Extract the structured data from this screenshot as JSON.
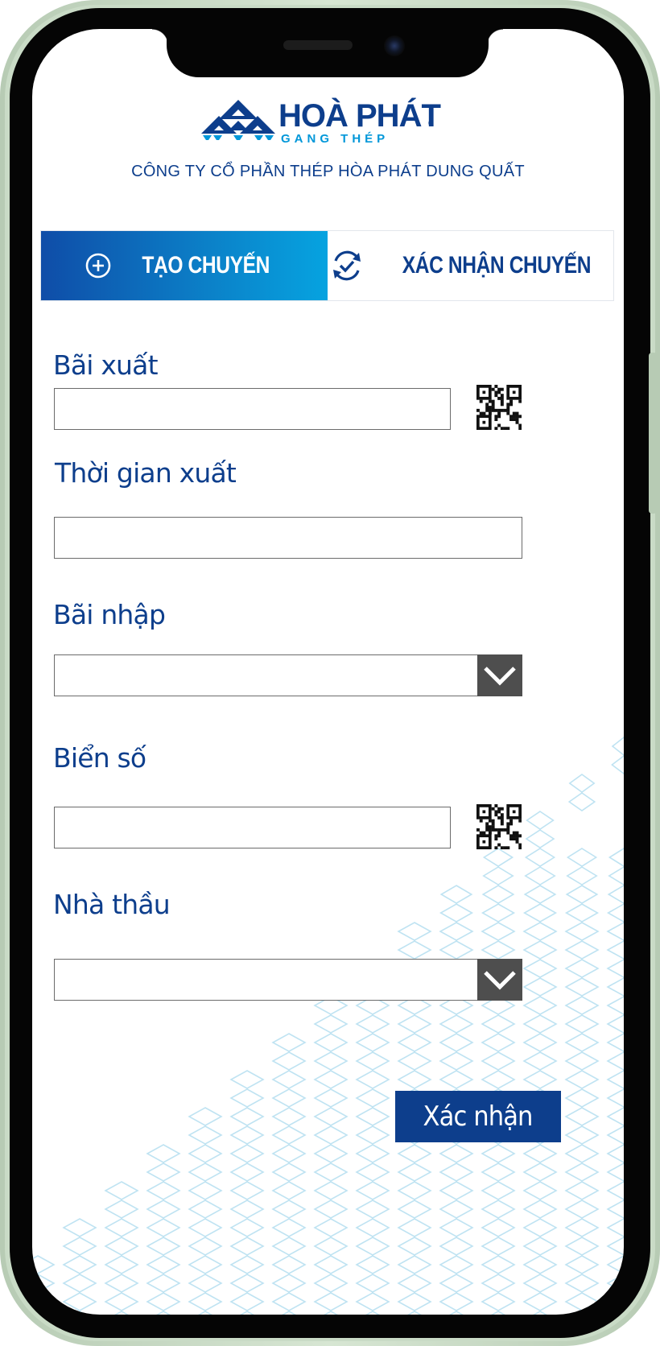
{
  "brand": {
    "name": "HOA PHAT",
    "name_display": "HOÀ PHÁT",
    "registered_mark": "®",
    "subtitle": "GANG THÉP",
    "company": "CÔNG TY CỔ PHẦN THÉP HÒA PHÁT DUNG QUẤT"
  },
  "tabs": [
    {
      "label": "TẠO CHUYẾN",
      "icon": "plus-circle-icon",
      "active": true
    },
    {
      "label": "XÁC NHẬN CHUYẾN",
      "icon": "refresh-check-icon",
      "active": false
    }
  ],
  "form": {
    "bai_xuat": {
      "label": "Bãi xuất",
      "value": "",
      "icon": "qr-code-icon"
    },
    "thoi_gian_xuat": {
      "label": "Thời gian xuất",
      "value": ""
    },
    "bai_nhap": {
      "label": "Bãi nhập",
      "value": "",
      "icon": "chevron-down-icon"
    },
    "bien_so": {
      "label": "Biển số",
      "value": "",
      "icon": "qr-code-icon"
    },
    "nha_thau": {
      "label": "Nhà thầu",
      "value": "",
      "icon": "chevron-down-icon"
    },
    "submit_label": "Xác nhận"
  },
  "colors": {
    "brand_blue": "#0d3e8c",
    "accent_cyan": "#0097d9",
    "select_button": "#4e4e4e",
    "pattern": "#bfe3f2"
  }
}
